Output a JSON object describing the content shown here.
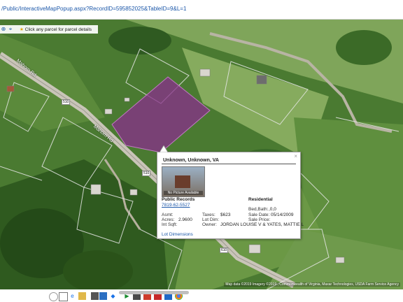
{
  "browser": {
    "url": "/Public/InteractiveMapPopup.aspx?RecordID=595852025&TableID=9&L=1"
  },
  "map_toolbar": {
    "hint_text": "Click any parcel for parcel details",
    "icons": [
      "globe-icon",
      "locate-icon",
      "star-icon"
    ]
  },
  "map": {
    "road_labels": [
      "Mahorn Rd",
      "Mahorn Rd",
      "510",
      "510",
      "610",
      "510"
    ],
    "attribution": "Map data ©2019 Imagery ©2019 , Commonwealth of Virginia, Maxar Technologies, USDA Farm Service Agency"
  },
  "popup": {
    "title": "Unknown, Unknown, VA",
    "photo_caption": "No Picture Available",
    "section_left": "Public Records",
    "parcel_id": "7819-62-5527",
    "section_right": "Residential",
    "fields": {
      "asmt_label": "Asmt:",
      "asmt_value": "",
      "acres_label": "Acres:",
      "acres_value": "2.9600",
      "intsqft_label": "Int Sqft:",
      "intsqft_value": "",
      "taxes_label": "Taxes:",
      "taxes_value": "$623",
      "lotdim_label": "Lot Dim:",
      "lotdim_value": "",
      "owner_label": "Owner:",
      "owner_value": "JORDAN LOUISE V & YATES, MATTIE L",
      "bedbath_label": "Bed,Bath:",
      "bedbath_value": ",0,0",
      "saledate_label": "Sale Date:",
      "saledate_value": "05/14/2009",
      "saleprice_label": "Sale Price:",
      "saleprice_value": ""
    },
    "lot_dimensions_link": "Lot Dimensions",
    "close_glyph": "×"
  },
  "colors": {
    "highlight_parcel": "#8a2f8c",
    "link": "#1a56a8"
  }
}
